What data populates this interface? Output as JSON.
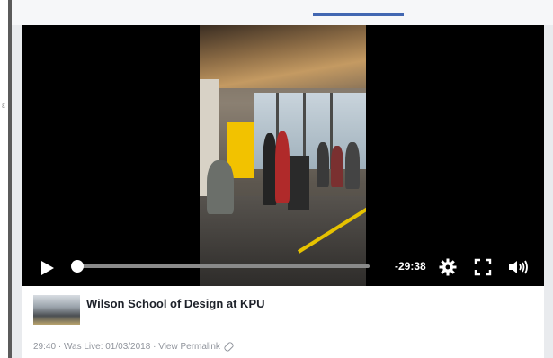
{
  "tabs": {
    "active_indicator": "#4267b2"
  },
  "video": {
    "time_remaining": "-29:38",
    "progress_fraction": 0.01,
    "controls": {
      "play_icon": "play-icon",
      "settings_icon": "gear-icon",
      "fullscreen_icon": "fullscreen-icon",
      "volume_icon": "volume-icon"
    }
  },
  "post": {
    "page_name": "Wilson School of Design at KPU",
    "duration": "29:40",
    "separator": "·",
    "was_live": "Was Live: 01/03/2018",
    "permalink": "View Permalink"
  },
  "colors": {
    "accent": "#4267b2",
    "player_bg": "#000000",
    "meta_text": "#90949c"
  }
}
